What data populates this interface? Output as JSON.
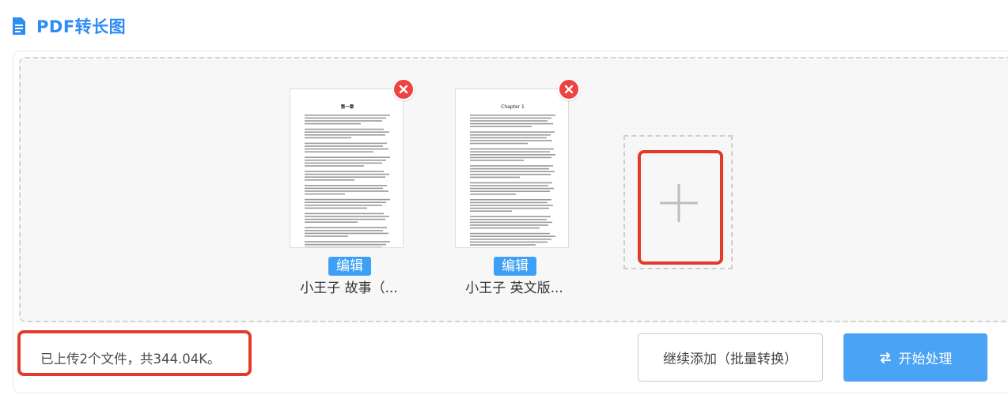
{
  "header": {
    "icon": "document-icon",
    "title": "PDF转长图"
  },
  "files": [
    {
      "name": "小王子 故事（...",
      "edit_label": "编辑",
      "thumb_heading": "第一章"
    },
    {
      "name": "小王子 英文版...",
      "edit_label": "编辑",
      "thumb_heading": "Chapter 1"
    }
  ],
  "add_tile": {
    "icon": "plus-icon"
  },
  "status": {
    "text": "已上传2个文件，共344.04K。"
  },
  "actions": {
    "continue_label": "继续添加（批量转换）",
    "start_label": "开始处理",
    "start_icon": "swap-icon"
  },
  "colors": {
    "accent": "#2f8cf4",
    "primary_button": "#4aa3f4",
    "remove": "#ee4343",
    "highlight": "#e23b2a"
  }
}
